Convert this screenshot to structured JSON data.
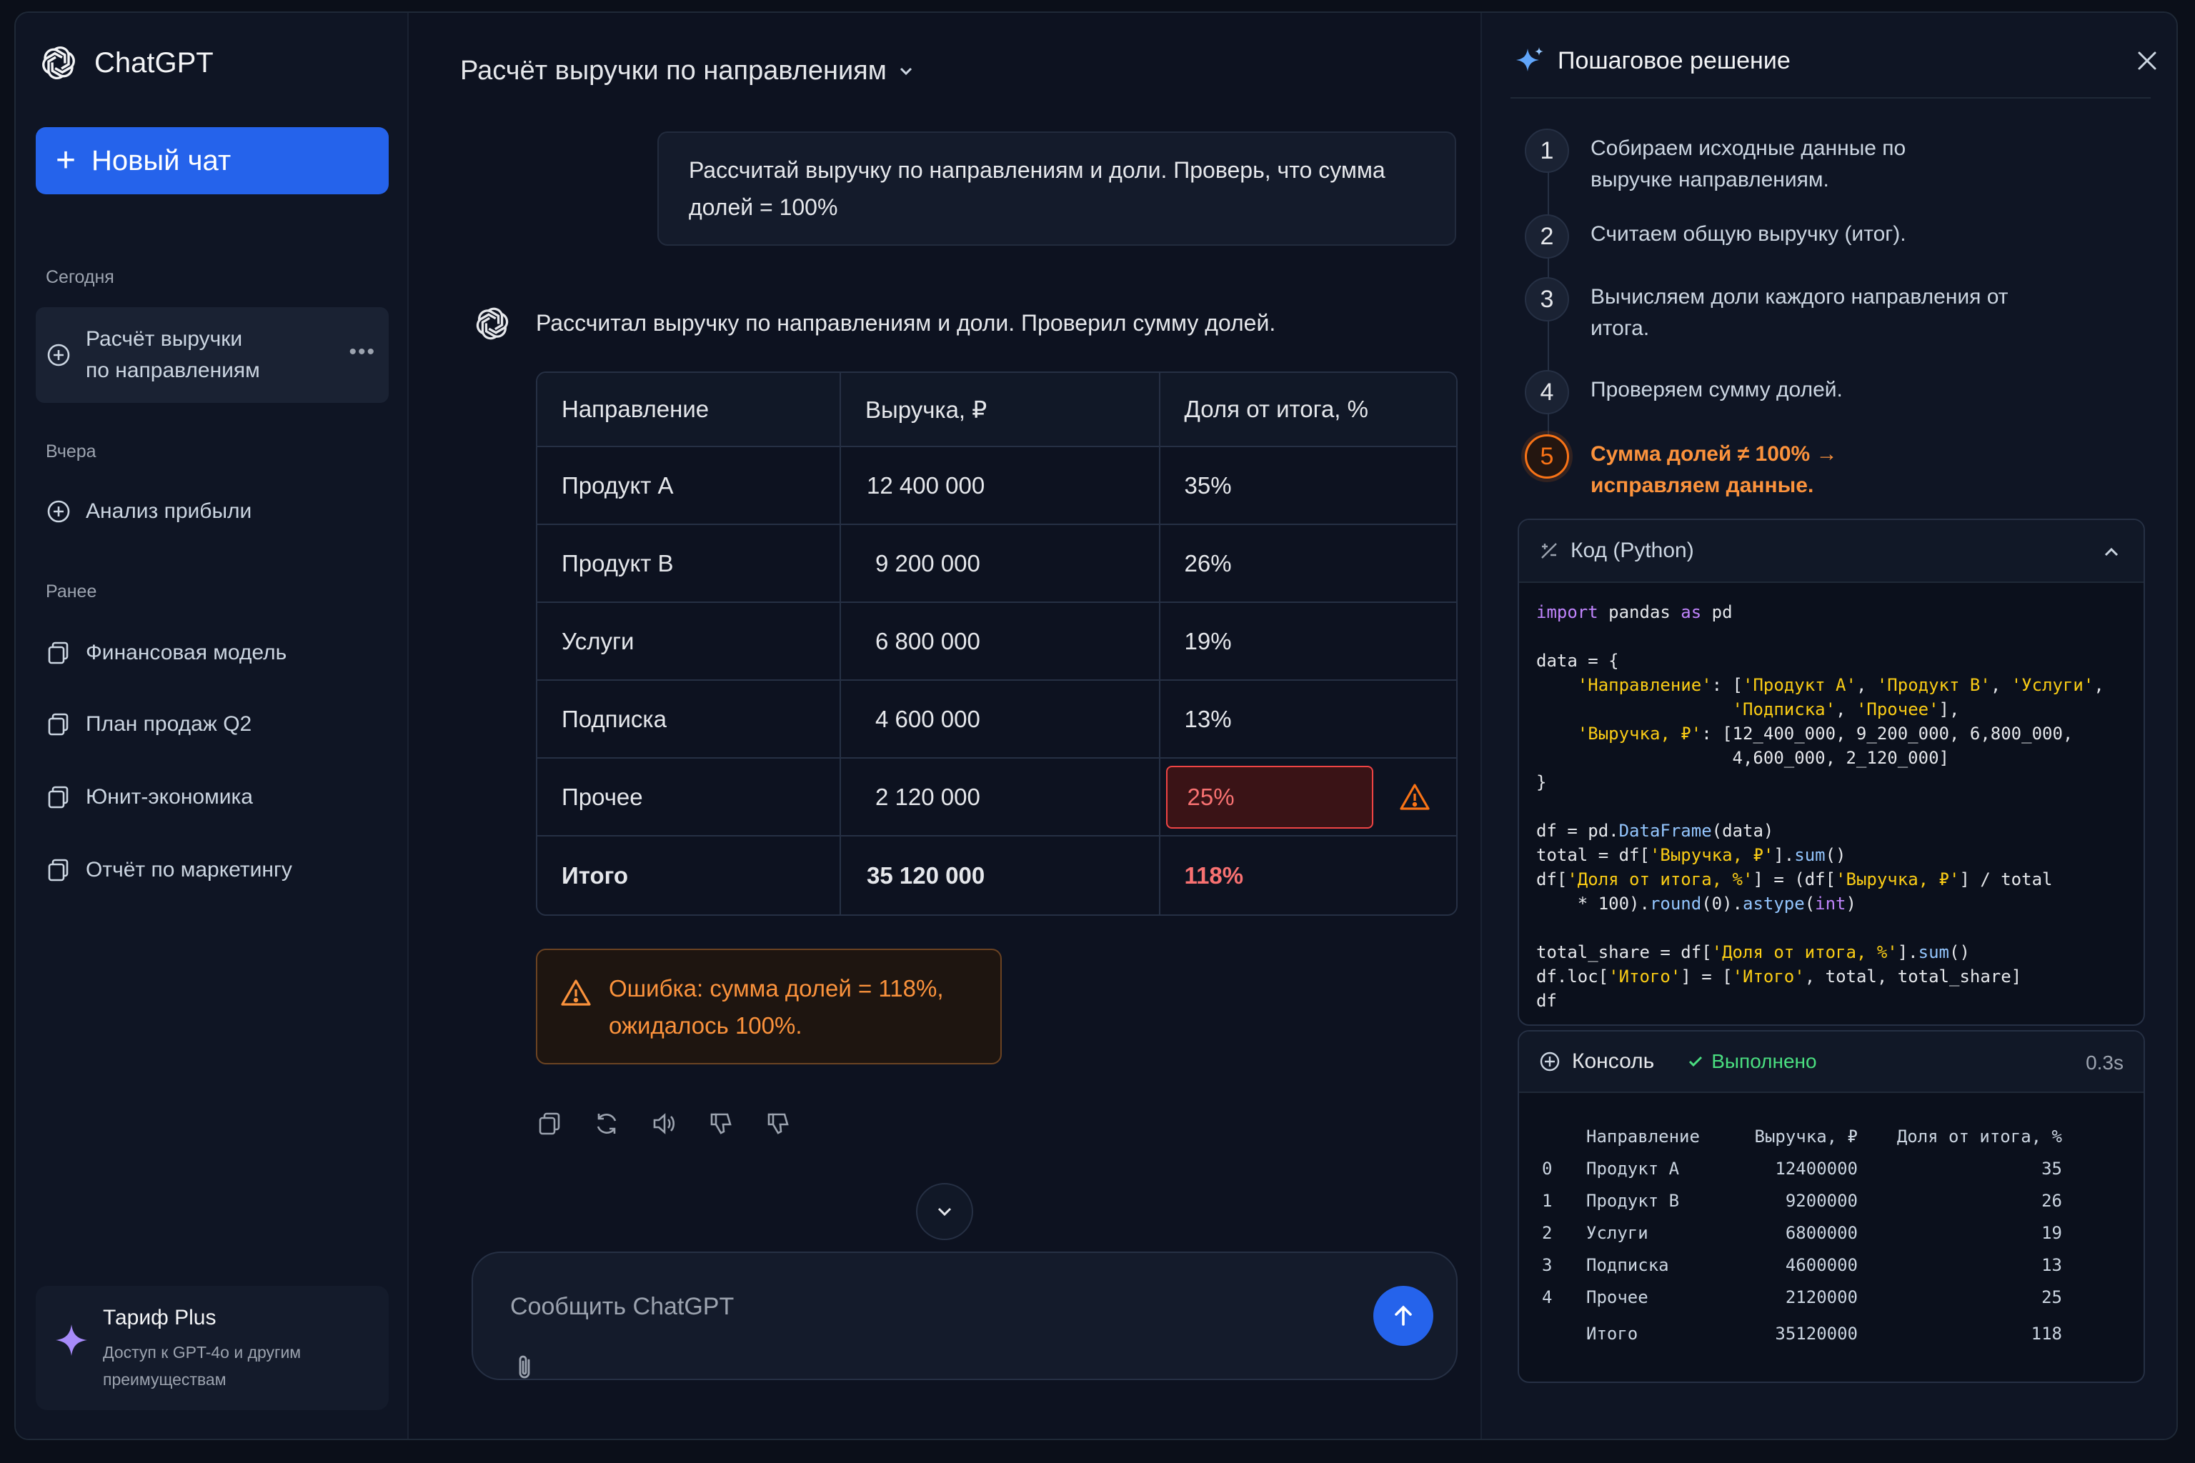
{
  "sidebar": {
    "brand": "ChatGPT",
    "new_chat": "Новый чат",
    "sections": {
      "today": "Сегодня",
      "yesterday": "Вчера",
      "earlier": "Ранее"
    },
    "items": {
      "active_line1": "Расчёт выручки",
      "active_line2": "по направлениям",
      "profit": "Анализ прибыли",
      "finmodel": "Финансовая модель",
      "sales_plan": "План продаж Q2",
      "unit_econ": "Юнит-экономика",
      "marketing": "Отчёт по маркетингу"
    },
    "plan": {
      "title": "Тариф Plus",
      "desc": "Доступ к GPT-4o и другим преимуществам"
    }
  },
  "main": {
    "chat_title": "Расчёт выручки по направлениям",
    "user_message": "Рассчитай выручку по направлениям и доли. Проверь, что сумма долей = 100%",
    "assistant_text": "Рассчитал выручку по направлениям и доли. Проверил сумму долей.",
    "table": {
      "headers": [
        "Направление",
        "Выручка, ₽",
        "Доля от итога, %"
      ],
      "rows": [
        [
          "Продукт A",
          "12 400 000",
          "35%"
        ],
        [
          "Продукт B",
          "9 200 000",
          "26%"
        ],
        [
          "Услуги",
          "6 800 000",
          "19%"
        ],
        [
          "Подписка",
          "4 600 000",
          "13%"
        ],
        [
          "Прочее",
          "2 120 000",
          "25%"
        ]
      ],
      "total": [
        "Итого",
        "35 120 000",
        "118%"
      ]
    },
    "error_note": "Ошибка: сумма долей = 118%, ожидалось 100%.",
    "composer_placeholder": "Сообщить ChatGPT"
  },
  "panel": {
    "title": "Пошаговое решение",
    "steps": [
      {
        "n": "1",
        "text": "Собираем исходные данные по выручке направлениям."
      },
      {
        "n": "2",
        "text": "Считаем общую выручку (итог)."
      },
      {
        "n": "3",
        "text": "Вычисляем доли каждого направления от итога."
      },
      {
        "n": "4",
        "text": "Проверяем сумму долей."
      },
      {
        "n": "5",
        "text": "Сумма долей ≠ 100% → исправляем данные."
      }
    ],
    "code_title": "Код (Python)",
    "console_title": "Консоль",
    "console_status": "Выполнено",
    "console_time": "0.3s",
    "console": {
      "headers": [
        "",
        "Направление",
        "Выручка, ₽",
        "Доля от итога, %"
      ],
      "rows": [
        [
          "0",
          "Продукт A",
          "12400000",
          "35"
        ],
        [
          "1",
          "Продукт B",
          "9200000",
          "26"
        ],
        [
          "2",
          "Услуги",
          "6800000",
          "19"
        ],
        [
          "3",
          "Подписка",
          "4600000",
          "13"
        ],
        [
          "4",
          "Прочее",
          "2120000",
          "25"
        ]
      ],
      "total": [
        "",
        "Итого",
        "35120000",
        "118"
      ]
    }
  },
  "colors": {
    "accent": "#2563eb",
    "error": "#ef4444",
    "warning": "#f97316",
    "success": "#4ade80"
  }
}
